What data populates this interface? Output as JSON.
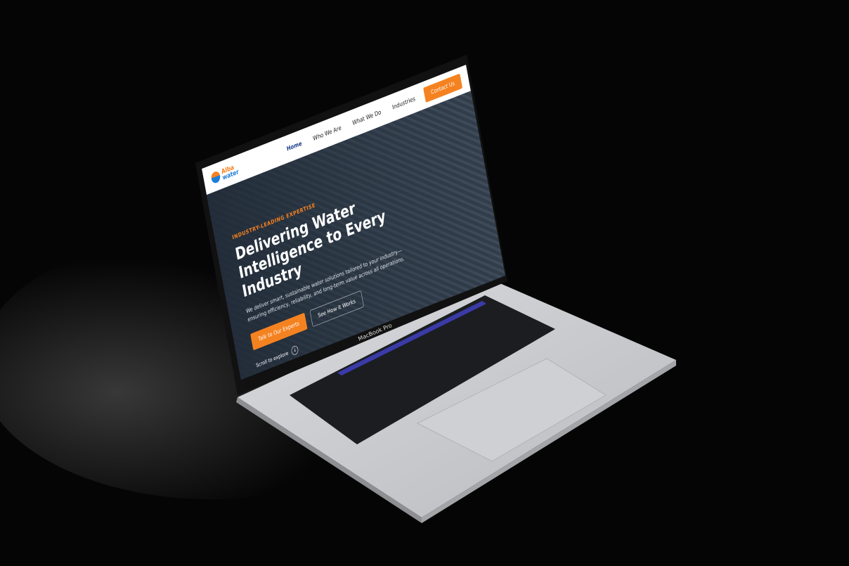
{
  "device": {
    "label": "MacBook Pro"
  },
  "site": {
    "logo": {
      "line1": "Alba",
      "line2": "water"
    },
    "nav": [
      {
        "label": "Home",
        "active": true
      },
      {
        "label": "Who We Are"
      },
      {
        "label": "What We Do"
      },
      {
        "label": "Industries"
      }
    ],
    "contact_label": "Contact Us",
    "hero": {
      "kicker": "INDUSTRY-LEADING EXPERTISE",
      "title": "Delivering Water Intelligence to Every Industry",
      "description": "We deliver smart, sustainable water solutions tailored to your industry—ensuring efficiency, reliability, and long-term value across all operations.",
      "primary_cta": "Talk to Our Experts",
      "secondary_cta": "See How it Works",
      "scroll_label": "Scroll to explore"
    }
  },
  "colors": {
    "accent": "#f58220",
    "brand_blue": "#1e7fd6",
    "nav_active": "#1d3f8a"
  }
}
